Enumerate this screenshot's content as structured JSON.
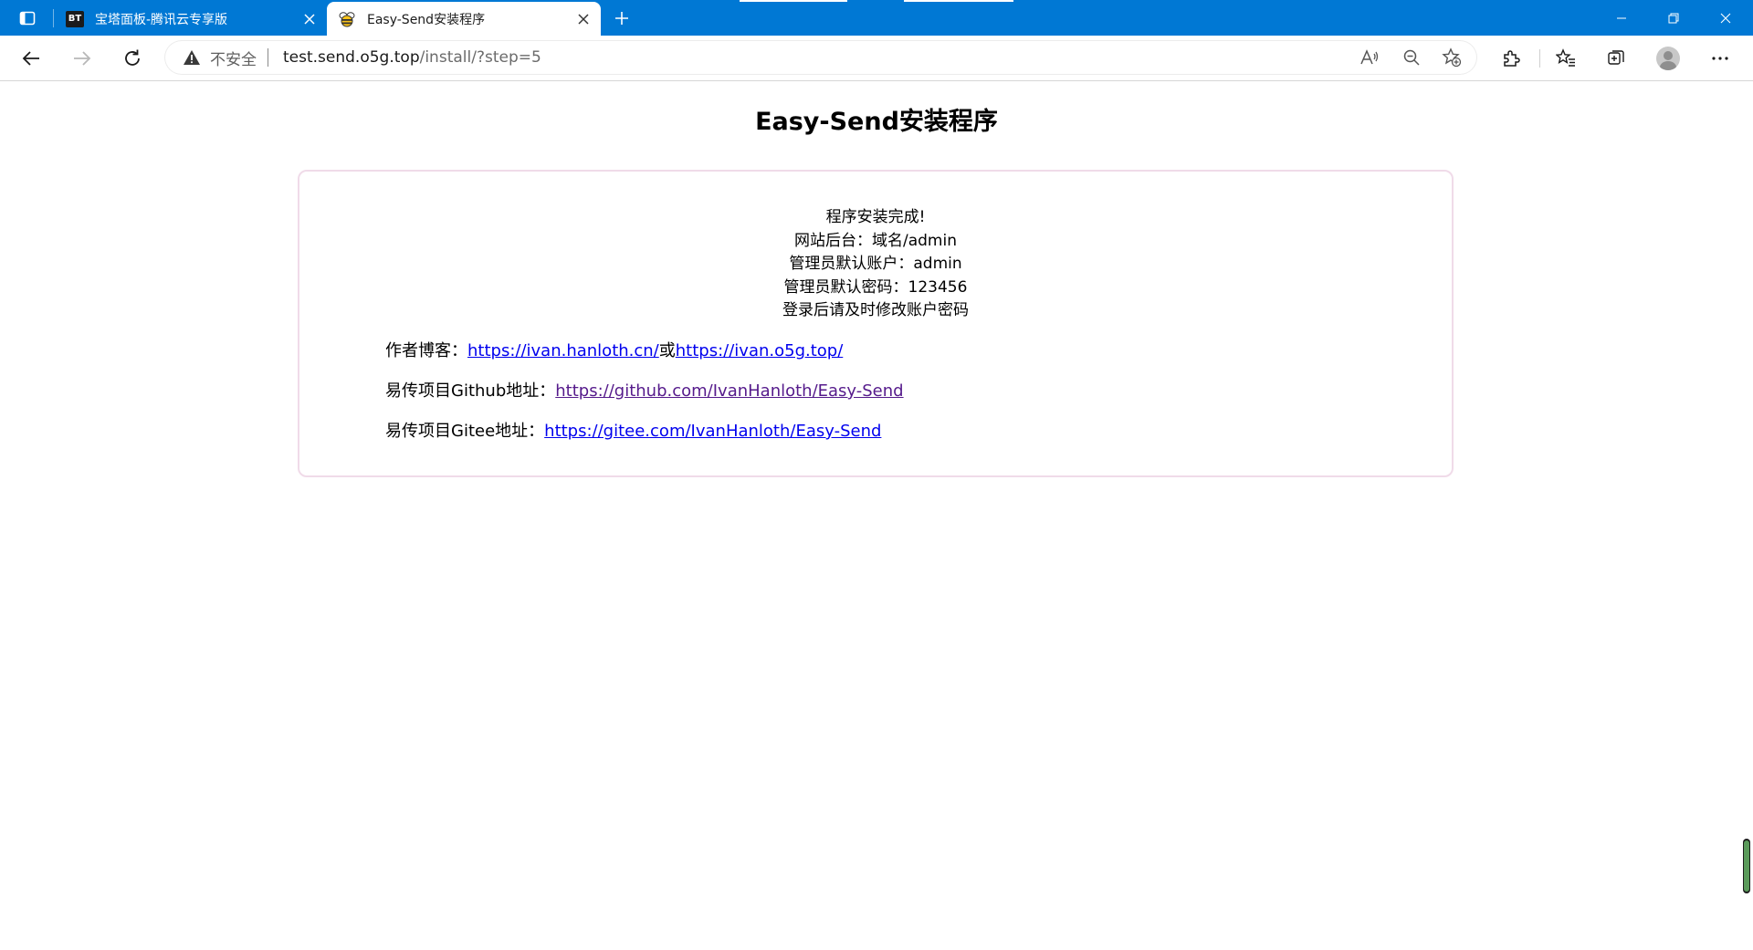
{
  "browser": {
    "tabs": [
      {
        "title": "宝塔面板-腾讯云专享版",
        "favicon_text": "BT",
        "active": false
      },
      {
        "title": "Easy-Send安装程序",
        "active": true
      }
    ],
    "security_label": "不安全",
    "url_host": "test.send.o5g.top",
    "url_path": "/install/?step=5"
  },
  "page": {
    "title": "Easy-Send安装程序",
    "message_lines": [
      "程序安装完成!",
      "网站后台：域名/admin",
      "管理员默认账户：admin",
      "管理员默认密码：123456",
      "登录后请及时修改账户密码"
    ],
    "blog_label": "作者博客：",
    "blog_link1": "https://ivan.hanloth.cn/",
    "blog_or": "或",
    "blog_link2": "https://ivan.o5g.top/",
    "github_label": "易传项目Github地址：",
    "github_link": "https://github.com/IvanHanloth/Easy-Send",
    "gitee_label": "易传项目Gitee地址：",
    "gitee_link": "https://gitee.com/IvanHanloth/Easy-Send"
  },
  "colors": {
    "titlebar": "#0078d4",
    "link": "#0000ee",
    "visited_link": "#551a8b",
    "card_border": "#f0dbe9"
  }
}
